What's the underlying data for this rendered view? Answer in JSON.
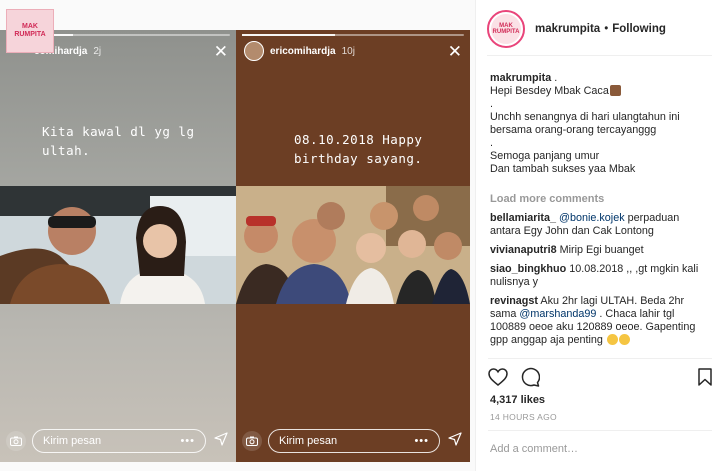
{
  "badge_text": "MAK RUMPITA",
  "stories": [
    {
      "user": "comihardja",
      "time": "2j",
      "text": "Kita kawal dl yg lg\nultah.",
      "message_placeholder": "Kirim pesan",
      "menu_dots": "•••"
    },
    {
      "user": "ericomihardja",
      "time": "10j",
      "text": "08.10.2018 Happy\nbirthday sayang.",
      "message_placeholder": "Kirim pesan",
      "menu_dots": "•••"
    }
  ],
  "post": {
    "username": "makrumpita",
    "separator": "•",
    "follow_status": "Following",
    "caption_user": "makrumpita",
    "caption_suffix": ".",
    "caption_lines": [
      "Hepi Besdey Mbak Caca",
      ".",
      "Unchh senangnya di hari ulangtahun ini bersama orang-orang tercayanggg",
      ".",
      "Semoga panjang umur",
      "Dan tambah sukses yaa Mbak"
    ],
    "load_more": "Load more comments",
    "comments": [
      {
        "user": "bellamiarita_",
        "mention": "@bonie.kojek",
        "text": " perpaduan antara Egy John dan Cak Lontong"
      },
      {
        "user": "vivianaputri8",
        "mention": "",
        "text": "Mirip Egi buanget"
      },
      {
        "user": "siao_bingkhuo",
        "mention": "",
        "text": "10.08.2018 ,, ,gt mgkin kali nulisnya y"
      },
      {
        "user": "revinagst",
        "mention": "",
        "text": "Aku 2hr lagi ULTAH. Beda 2hr sama ",
        "mention2": "@marshanda99",
        "text2": " . Chaca lahir tgl 100889 oeoe aku 120889 oeoe. Gapenting gpp anggap aja penting"
      }
    ],
    "likes": "4,317 likes",
    "time_ago": "14 HOURS AGO",
    "add_comment_placeholder": "Add a comment…"
  },
  "colors": {
    "story2_bg": "#6c3e24",
    "mention": "#003569",
    "muted": "#999999"
  }
}
